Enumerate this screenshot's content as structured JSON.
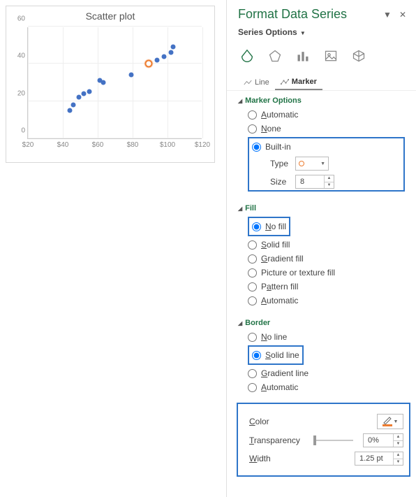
{
  "chart_data": {
    "type": "scatter",
    "title": "Scatter plot",
    "xlabel": "",
    "ylabel": "",
    "x_ticks": [
      "$20",
      "$40",
      "$60",
      "$80",
      "$100",
      "$120"
    ],
    "y_ticks": [
      "0",
      "20",
      "40",
      "60"
    ],
    "xlim": [
      20,
      120
    ],
    "ylim": [
      0,
      60
    ],
    "points": [
      {
        "x": 44,
        "y": 15
      },
      {
        "x": 46,
        "y": 18
      },
      {
        "x": 49,
        "y": 22
      },
      {
        "x": 52,
        "y": 24
      },
      {
        "x": 55,
        "y": 25
      },
      {
        "x": 61,
        "y": 31
      },
      {
        "x": 63,
        "y": 30
      },
      {
        "x": 79,
        "y": 34
      },
      {
        "x": 89,
        "y": 40,
        "highlight": true
      },
      {
        "x": 94,
        "y": 42
      },
      {
        "x": 98,
        "y": 44
      },
      {
        "x": 102,
        "y": 46
      },
      {
        "x": 103,
        "y": 49
      }
    ]
  },
  "panel": {
    "title": "Format Data Series",
    "subtitle": "Series Options"
  },
  "tabs": {
    "line": "Line",
    "marker": "Marker"
  },
  "marker_opts": {
    "head": "Marker Options",
    "automatic": "utomatic",
    "none": "one",
    "builtin": "Built-in",
    "type_label": "Type",
    "size_label": "Size",
    "size_value": "8"
  },
  "fill": {
    "head": "Fill",
    "no_fill": "o fill",
    "solid": "olid fill",
    "gradient": "radient fill",
    "picture": "Picture or texture fill",
    "pattern": "ttern fill",
    "automatic": "utomatic"
  },
  "border": {
    "head": "Border",
    "no_line": "o line",
    "solid": "olid line",
    "gradient": "radient line",
    "automatic": "utomatic"
  },
  "props": {
    "color_label": "olor",
    "transparency_label": "ransparency",
    "transparency_value": "0%",
    "width_label": "idth",
    "width_value": "1.25 pt"
  }
}
